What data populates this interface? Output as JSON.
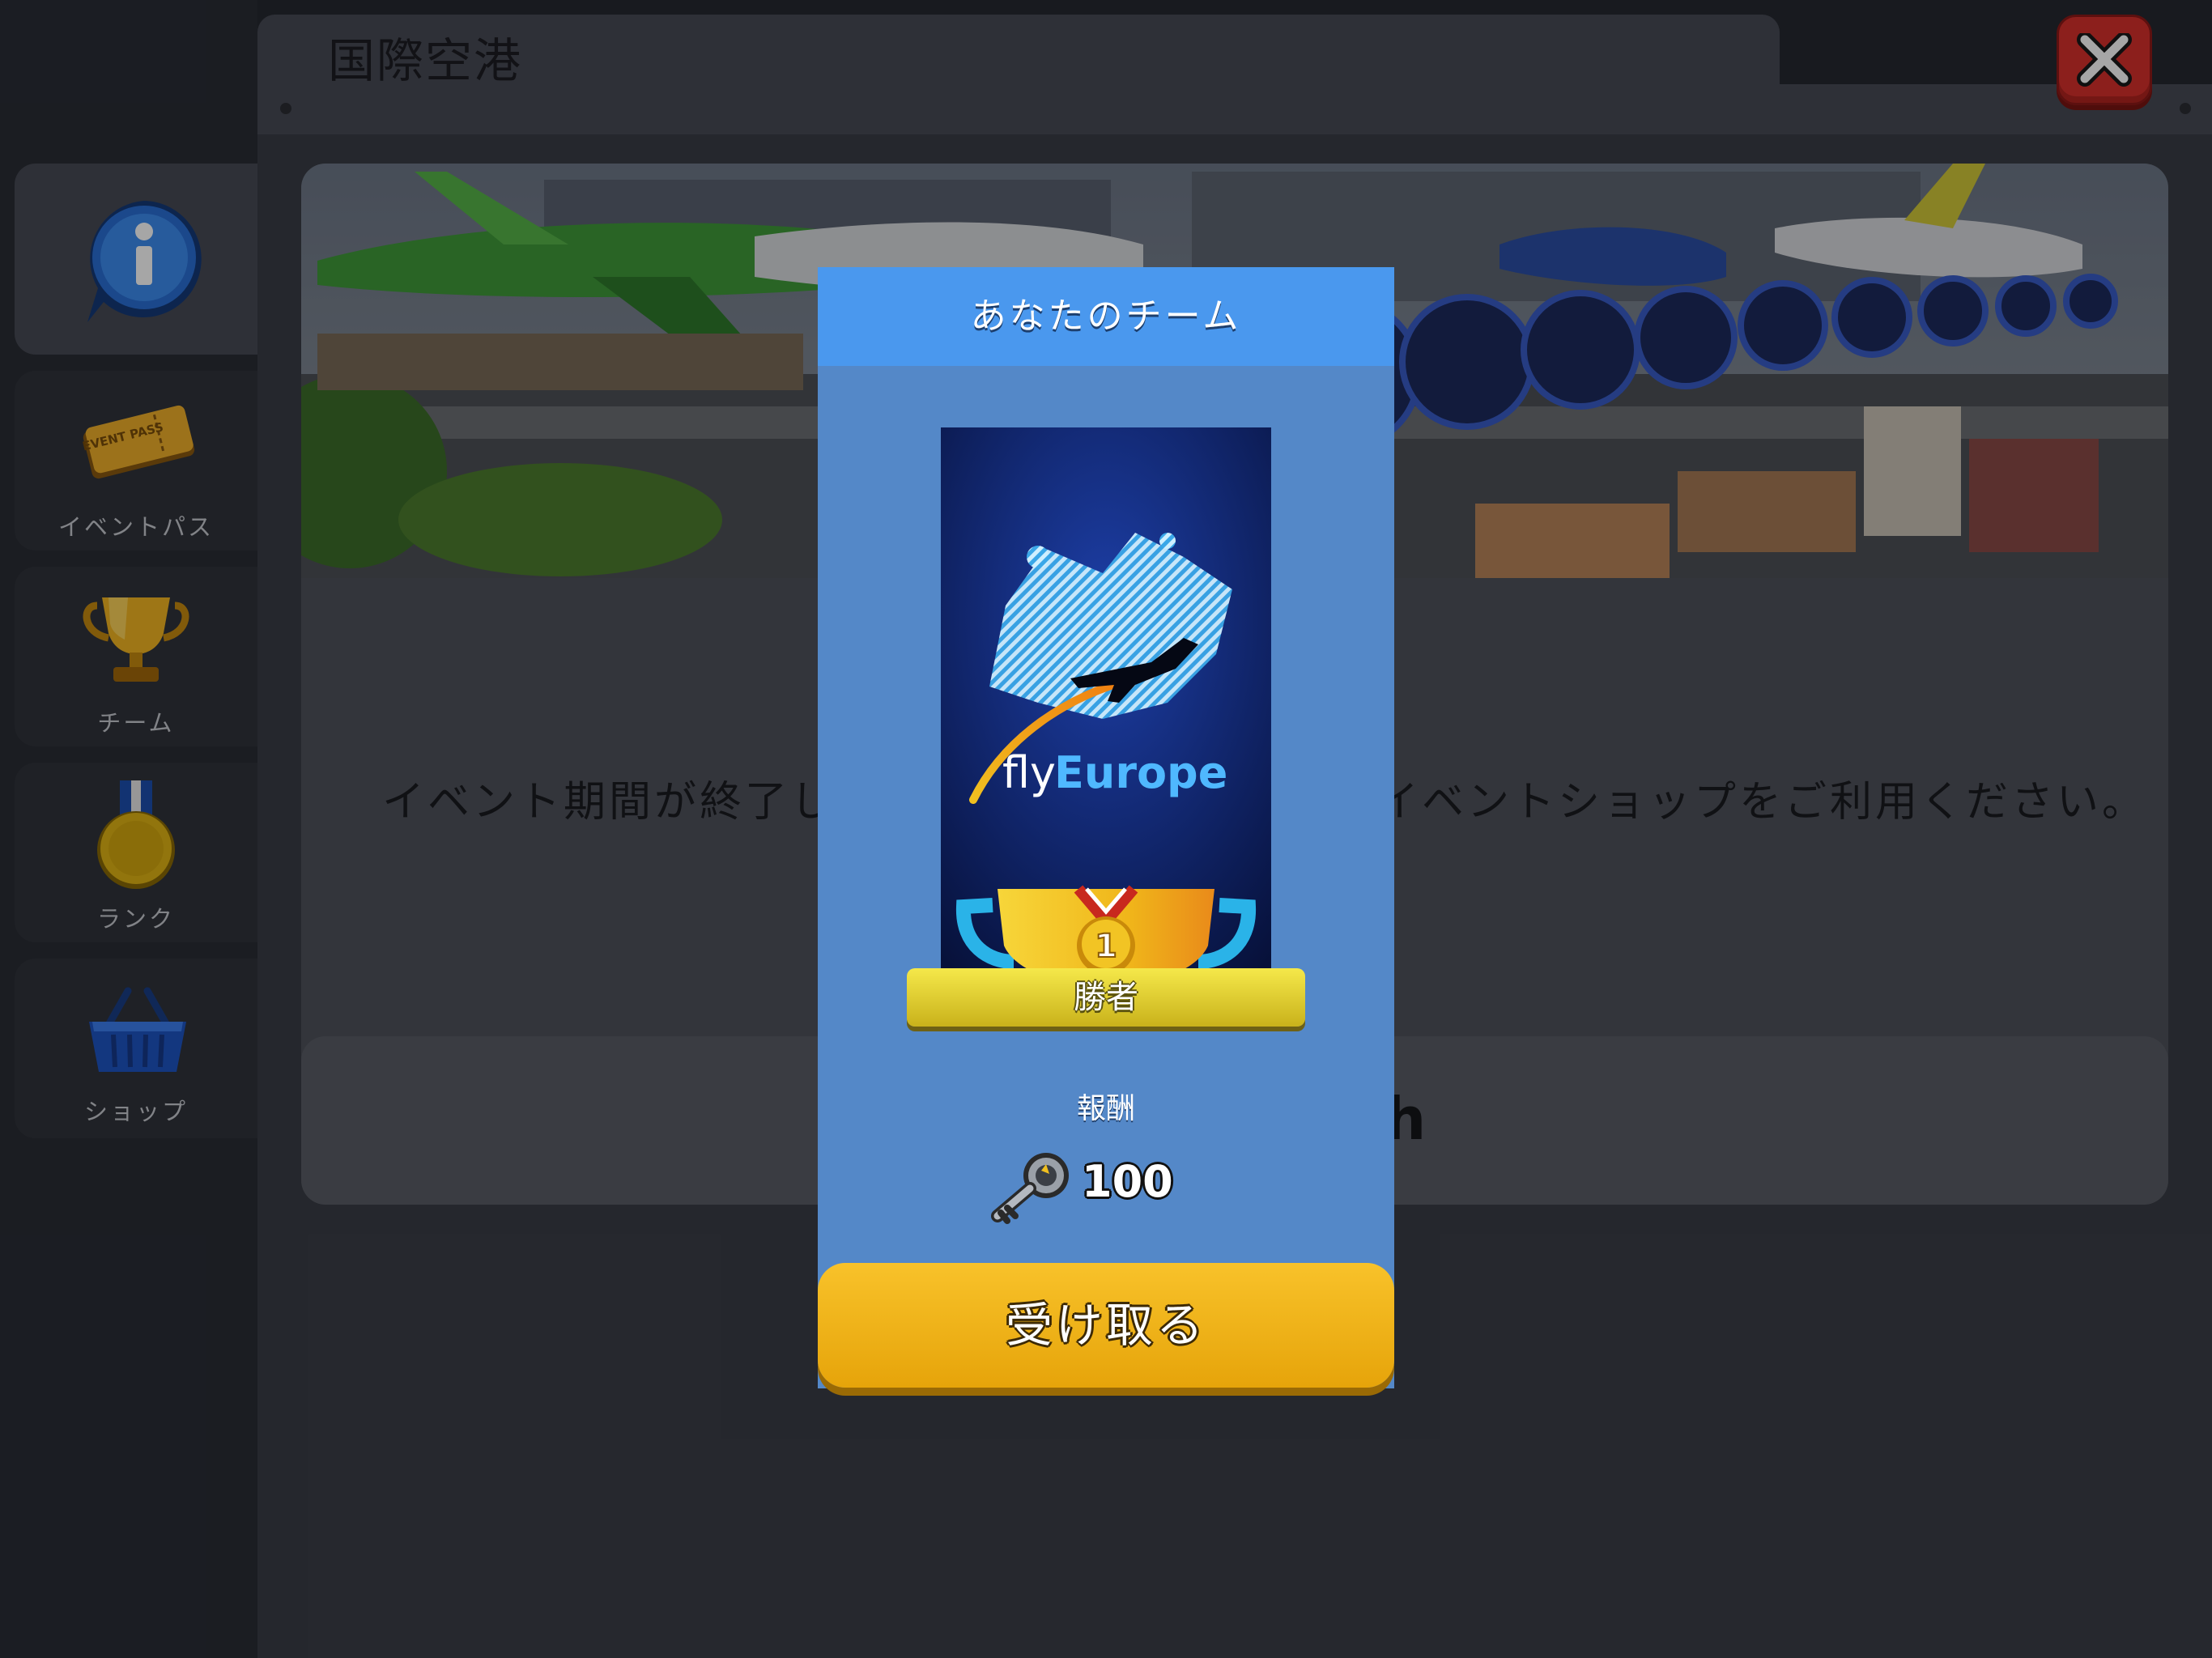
{
  "window": {
    "title": "国際空港"
  },
  "sidebar": {
    "items": [
      {
        "label": "",
        "icon": "info-icon",
        "active": true
      },
      {
        "label": "イベントパス",
        "icon": "event-pass-ticket-icon",
        "ticket_text": "EVENT PASS"
      },
      {
        "label": "チーム",
        "icon": "trophy-icon"
      },
      {
        "label": "ランク",
        "icon": "medal-icon"
      },
      {
        "label": "ショップ",
        "icon": "basket-icon"
      }
    ]
  },
  "main": {
    "banner": "airport-banner-image",
    "message_left": "イベント期間が終了し",
    "message_right": "イベントショップをご利用ください。",
    "subpanel_text": "h"
  },
  "modal": {
    "title": "あなたのチーム",
    "team_logo_text_prefix": "fly",
    "team_logo_text_suffix": "Europe",
    "winner_label": "勝者",
    "medal_rank": "1",
    "reward_label": "報酬",
    "reward_amount": "100",
    "reward_icon": "key-icon",
    "claim_button": "受け取る"
  },
  "colors": {
    "modal_header": "#4a98ee",
    "modal_body": "#5488c8",
    "claim_button": "#f2b41c",
    "close_button": "#d7302c",
    "winner_ribbon": "#e8d532"
  }
}
